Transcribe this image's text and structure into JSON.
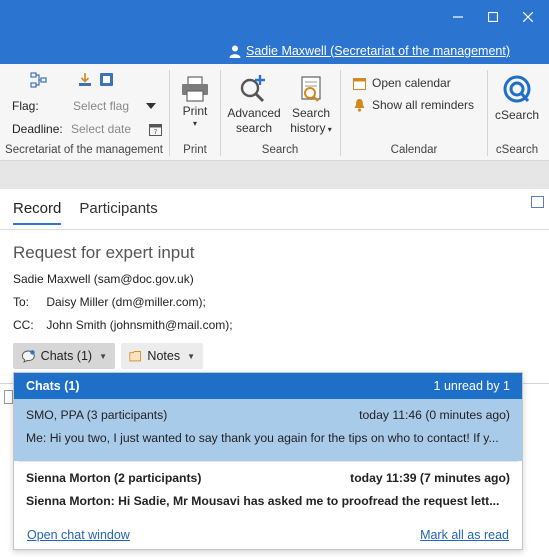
{
  "window": {
    "user_label": "Sadie Maxwell (Secretariat of the management)",
    "title_color": "#2b74cf"
  },
  "ribbon": {
    "flag_label": "Flag:",
    "flag_placeholder": "Select flag",
    "deadline_label": "Deadline:",
    "deadline_placeholder": "Select date",
    "group_secretariat": "Secretariat of the management",
    "print_label": "Print",
    "group_print": "Print",
    "advanced_search_line1": "Advanced",
    "advanced_search_line2": "search",
    "search_history_line1": "Search",
    "search_history_line2": "history",
    "group_search": "Search",
    "open_calendar": "Open calendar",
    "show_reminders": "Show all reminders",
    "group_calendar": "Calendar",
    "csearch_label": "cSearch",
    "group_csearch": "cSearch"
  },
  "record": {
    "tabs": [
      {
        "label": "Record"
      },
      {
        "label": "Participants"
      }
    ],
    "subject": "Request for expert input",
    "from": "Sadie Maxwell (sam@doc.gov.uk)",
    "to_label": "To:",
    "to_value": "Daisy Miller (dm@miller.com);",
    "cc_label": "CC:",
    "cc_value": "John Smith (johnsmith@mail.com);",
    "chats_button": "Chats (1)",
    "notes_button": "Notes"
  },
  "chats_popup": {
    "title": "Chats (1)",
    "unread_summary": "1 unread by 1",
    "items": [
      {
        "name": "SMO, PPA (3 participants)",
        "time": "today 11:46 (0 minutes ago)",
        "preview": "Me: Hi you two, I just wanted to say thank you again for the tips on who to contact! If y...",
        "selected": true,
        "unread": false
      },
      {
        "name": "Sienna Morton (2 participants)",
        "time": "today 11:39 (7 minutes ago)",
        "preview": "Sienna Morton: Hi Sadie,  Mr Mousavi has asked me to proofread the request lett...",
        "selected": false,
        "unread": true
      }
    ],
    "open_chat_window": "Open chat window",
    "mark_all_read": "Mark all as read"
  }
}
